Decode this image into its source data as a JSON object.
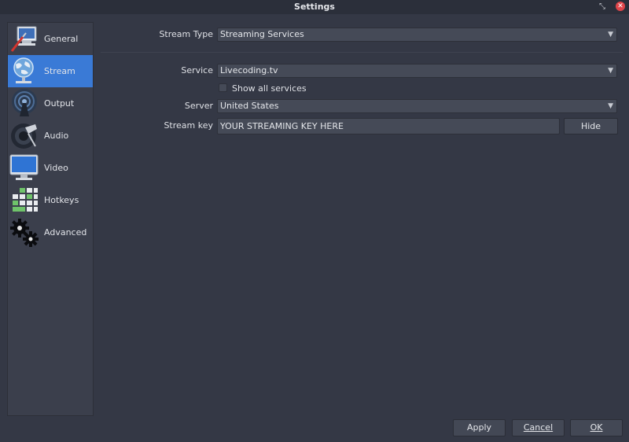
{
  "window": {
    "title": "Settings",
    "restore_glyph": "⤡",
    "close_glyph": "✕"
  },
  "sidebar": {
    "items": [
      {
        "label": "General",
        "icon": "general-icon"
      },
      {
        "label": "Stream",
        "icon": "stream-icon",
        "selected": true
      },
      {
        "label": "Output",
        "icon": "output-icon"
      },
      {
        "label": "Audio",
        "icon": "audio-icon"
      },
      {
        "label": "Video",
        "icon": "video-icon"
      },
      {
        "label": "Hotkeys",
        "icon": "hotkeys-icon"
      },
      {
        "label": "Advanced",
        "icon": "advanced-icon"
      }
    ]
  },
  "stream": {
    "stream_type_label": "Stream Type",
    "stream_type_value": "Streaming Services",
    "service_label": "Service",
    "service_value": "Livecoding.tv",
    "show_all_label": "Show all services",
    "show_all_checked": false,
    "server_label": "Server",
    "server_value": "United States",
    "key_label": "Stream key",
    "key_value": "YOUR STREAMING KEY HERE",
    "hide_label": "Hide"
  },
  "footer": {
    "apply_label": "Apply",
    "cancel_label": "Cancel",
    "ok_label": "OK"
  },
  "colors": {
    "background": "#343845",
    "sidebar": "#3b3f4c",
    "selection": "#3a7ad6",
    "field": "#454a57",
    "close_button": "#e0454a"
  }
}
